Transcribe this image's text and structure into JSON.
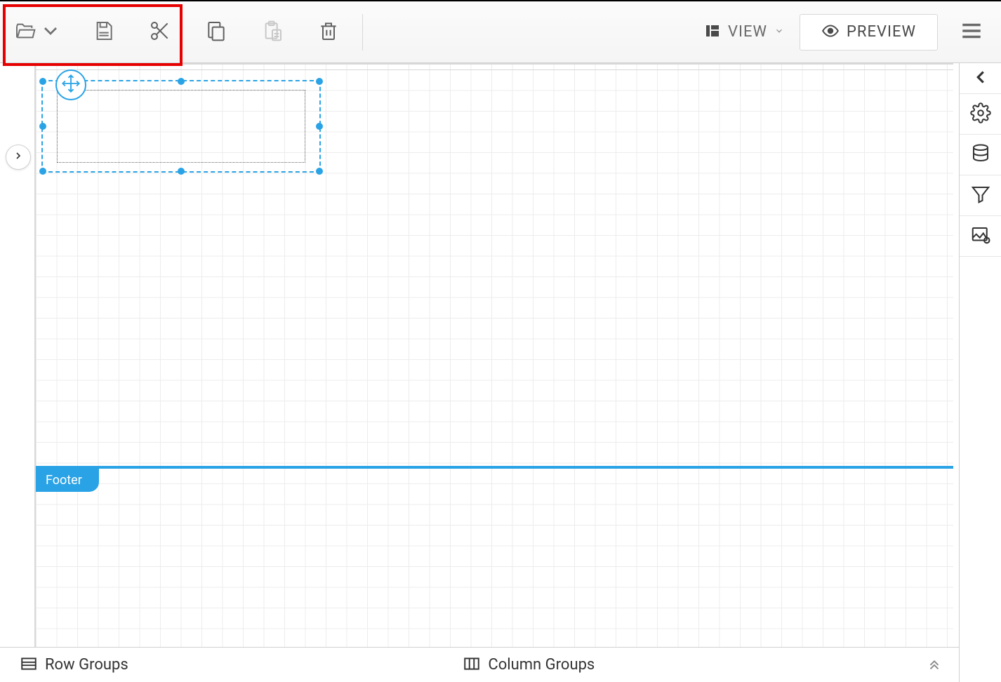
{
  "toolbar": {
    "open_label": "Open",
    "save_label": "Save",
    "cut_label": "Cut",
    "copy_label": "Copy",
    "paste_label": "Paste",
    "delete_label": "Delete",
    "view_label": "VIEW",
    "preview_label": "PREVIEW",
    "menu_label": "Menu"
  },
  "canvas": {
    "footer_label": "Footer"
  },
  "bottom": {
    "row_groups_label": "Row Groups",
    "column_groups_label": "Column Groups"
  },
  "right_rail": {
    "collapse": "Collapse",
    "settings": "Settings",
    "data": "Data",
    "filter": "Filter",
    "image_settings": "Image Settings"
  }
}
